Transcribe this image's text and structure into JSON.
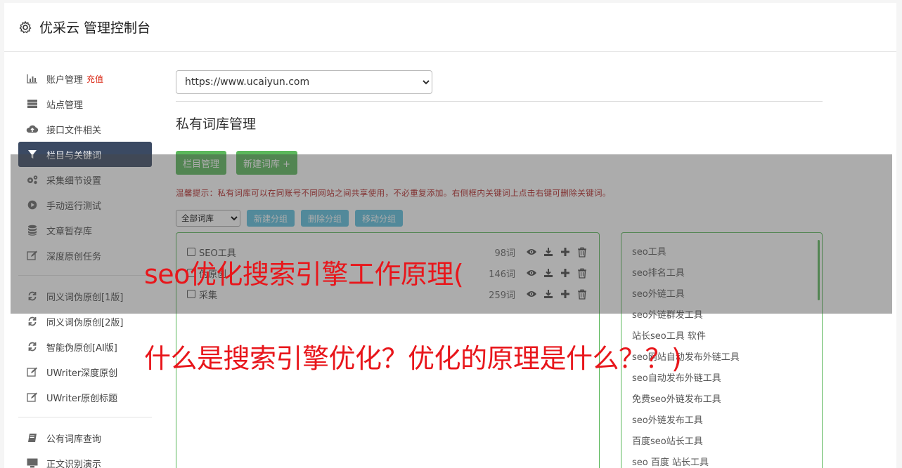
{
  "header": {
    "title": "优采云 管理控制台",
    "icon": "gear-icon"
  },
  "sidebar": {
    "items": [
      {
        "label": "账户管理",
        "badge": "充值",
        "icon": "bar-chart-icon"
      },
      {
        "label": "站点管理",
        "icon": "server-icon"
      },
      {
        "label": "接口文件相关",
        "icon": "cloud-upload-icon"
      },
      {
        "label": "栏目与关键词",
        "icon": "filter-icon",
        "active": true
      },
      {
        "label": "采集细节设置",
        "icon": "cogs-icon"
      },
      {
        "label": "手动运行测试",
        "icon": "play-circle-icon"
      },
      {
        "label": "文章暂存库",
        "icon": "database-icon"
      },
      {
        "label": "深度原创任务",
        "icon": "edit-icon"
      }
    ],
    "items2": [
      {
        "label": "同义词伪原创[1版]",
        "icon": "refresh-icon"
      },
      {
        "label": "同义词伪原创[2版]",
        "icon": "refresh-icon"
      },
      {
        "label": "智能伪原创[AI版]",
        "icon": "refresh-icon"
      },
      {
        "label": "UWriter深度原创",
        "icon": "edit-icon"
      },
      {
        "label": "UWriter原创标题",
        "icon": "edit-icon"
      }
    ],
    "items3": [
      {
        "label": "公有词库查询",
        "icon": "book-icon"
      },
      {
        "label": "正文识别演示",
        "icon": "monitor-icon"
      }
    ]
  },
  "main": {
    "site_select": "https://www.ucaiyun.com",
    "section_title": "私有词库管理",
    "buttons": {
      "columns": "栏目管理",
      "new_lib": "新建词库 +"
    },
    "tip": "温馨提示：私有词库可以在同账号不同网站之间共享使用，不必重复添加。右侧框内关键词上点击右键可删除关键词。",
    "group_select": "全部词库",
    "group_buttons": {
      "new": "新建分组",
      "delete": "删除分组",
      "move": "移动分组"
    },
    "libraries": [
      {
        "name": "SEO工具",
        "count": "98词"
      },
      {
        "name": "伪原创",
        "count": "146词"
      },
      {
        "name": "采集",
        "count": "259词"
      }
    ],
    "keywords": [
      "seo工具",
      "seo排名工具",
      "seo外链工具",
      "seo外链群发工具",
      "站长seo工具 软件",
      "seo网站自动发布外链工具",
      "seo自动发布外链工具",
      "免费seo外链发布工具",
      "seo外链发布工具",
      "百度seo站长工具",
      "seo 百度 站长工具"
    ]
  },
  "overlay": {
    "line1": "seo优化搜索引擎工作原理(",
    "line2": "什么是搜索引擎优化？优化的原理是什么？？)"
  },
  "colors": {
    "accent_green": "#5cb85c",
    "info_blue": "#5bc0de",
    "active_nav": "#3b4a63",
    "headline_red": "#e8161b"
  }
}
